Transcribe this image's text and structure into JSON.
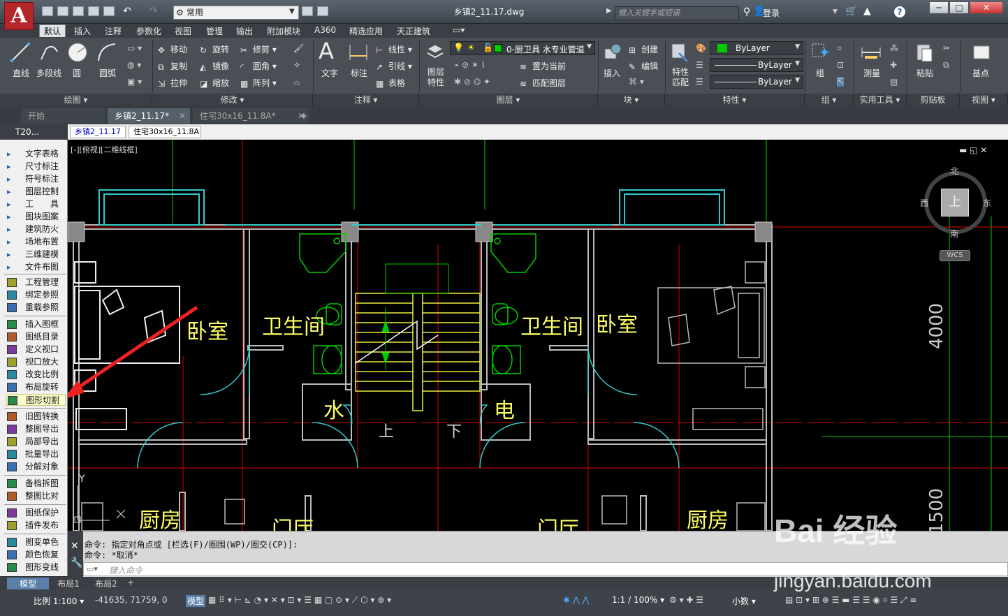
{
  "titlebar": {
    "app_logo": "A",
    "workspace": "常用",
    "doc_title": "乡镇2_11.17.dwg",
    "search_placeholder": "键入关键字或短语",
    "login": "登录"
  },
  "ribbon_tabs": [
    "默认",
    "插入",
    "注释",
    "参数化",
    "视图",
    "管理",
    "输出",
    "附加模块",
    "A360",
    "精选应用",
    "天正建筑"
  ],
  "ribbon": {
    "draw": {
      "line": "直线",
      "polyline": "多段线",
      "circle": "圆",
      "arc": "圆弧",
      "panel": "绘图"
    },
    "modify": {
      "move": "移动",
      "rotate": "旋转",
      "trim": "修剪",
      "copy": "复制",
      "mirror": "镜像",
      "fillet": "圆角",
      "stretch": "拉伸",
      "scale": "缩放",
      "array": "阵列",
      "panel": "修改"
    },
    "annotation": {
      "text": "文字",
      "dimension": "标注",
      "linetype": "线性",
      "leader": "引线",
      "table": "表格",
      "panel": "注释"
    },
    "layers": {
      "layer_props": "图层\n特性",
      "current_layer": "0-厨卫具 水专业管道",
      "make_current": "置为当前",
      "match_layer": "匹配图层",
      "panel": "图层"
    },
    "block": {
      "insert": "插入",
      "create": "创建",
      "edit": "编辑",
      "panel": "块"
    },
    "properties": {
      "match": "特性\n匹配",
      "color": "ByLayer",
      "linetype": "ByLayer",
      "lineweight": "ByLayer",
      "panel": "特性"
    },
    "groups": {
      "group": "组",
      "panel": "组"
    },
    "utilities": {
      "measure": "测量",
      "panel": "实用工具"
    },
    "clipboard": {
      "paste": "粘贴",
      "panel": "剪贴板"
    },
    "view": {
      "base": "基点",
      "panel": "视图"
    }
  },
  "doc_tabs": [
    "开始",
    "乡镇2_11.17*",
    "住宅30x16_11.8A*"
  ],
  "t20": {
    "title": "T20...",
    "tab1": "乡镇2_11.17",
    "tab2": "住宅30x16_11.8A"
  },
  "palette": [
    "文字表格",
    "尺寸标注",
    "符号标注",
    "图层控制",
    "工　　具",
    "图块图案",
    "建筑防火",
    "场地布置",
    "三维建模",
    "文件布图",
    "工程管理",
    "绑定参照",
    "重载参照",
    "插入图框",
    "图纸目录",
    "定义视口",
    "视口放大",
    "改变比例",
    "布局旋转",
    "图形切割",
    "旧图转换",
    "整图导出",
    "局部导出",
    "批量导出",
    "分解对象",
    "备档拆图",
    "整图比对",
    "图纸保护",
    "插件发布",
    "图变单色",
    "颜色恢复",
    "图形变线"
  ],
  "viewport_label": "[-][俯视][二维线框]",
  "viewcube": {
    "north": "北",
    "south": "南",
    "east": "东",
    "west": "西",
    "top": "上",
    "wcs": "WCS"
  },
  "drawing": {
    "rooms": [
      "卧室",
      "卫生间",
      "卫生间",
      "卧室",
      "水",
      "电",
      "厨房",
      "门厅",
      "门厅",
      "厨房"
    ],
    "stair_up": "上",
    "stair_down": "下",
    "dim1": "4000",
    "dim2": "1500",
    "ucs_y": "Y"
  },
  "command": {
    "line1": "命令: 指定对角点或 [栏选(F)/圈围(WP)/圈交(CP)]:",
    "line2": "命令: *取消*",
    "placeholder": "键入命令"
  },
  "layout_tabs": [
    "模型",
    "布局1",
    "布局2"
  ],
  "status": {
    "scale": "比例 1:100",
    "coords": "-41635, 71759, 0",
    "model": "模型",
    "annot_scale": "1:1 / 100%",
    "units": "小数"
  },
  "watermark": {
    "brand": "Bai 经验",
    "url": "jingyan.baidu.com"
  }
}
